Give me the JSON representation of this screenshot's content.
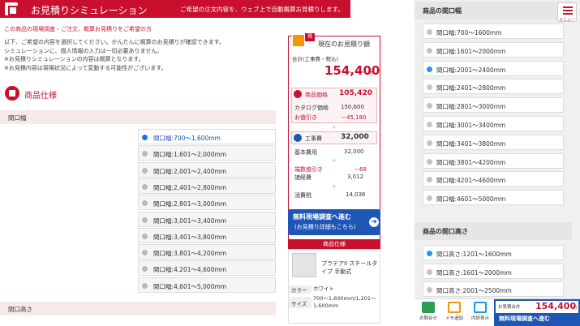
{
  "header": {
    "title": "お見積りシミュレーション",
    "subtitle": "ご希望の注文内容を、ウェブ上で自動概算お見積りします。"
  },
  "note_red": "この商品の現場調査・ご注文、概算お見積りをご希望の方",
  "intro": [
    "以下、ご希望の内容を選択してください。かんたんに概算のお見積りが確認できます。",
    "シミュレーションに、個人情報の入力は一切必要ありません。",
    "※お見積りシミュレーションの内容は概算となります。",
    "※お見積内容は現場状況によって変動する可能性がございます。"
  ],
  "spec_title": "商品仕様",
  "width_section": {
    "label": "間口幅",
    "options": [
      "間口幅:700～1,600mm",
      "間口幅:1,601～2,000mm",
      "間口幅:2,001～2,400mm",
      "間口幅:2,401～2,800mm",
      "間口幅:2,801～3,000mm",
      "間口幅:3,001～3,400mm",
      "間口幅:3,401～3,800mm",
      "間口幅:3,801～4,200mm",
      "間口幅:4,201～4,600mm",
      "間口幅:4,601～5,000mm"
    ],
    "selected": 0
  },
  "height_section": {
    "label": "間口高さ"
  },
  "estimate": {
    "badge": "得",
    "title": "現在のお見積り額",
    "total_label": "合計(工事費・税込)",
    "total": "154,400",
    "yen": "円",
    "product_label": "商品価格",
    "product_price": "105,420",
    "catalog_label": "カタログ価格",
    "catalog_price": "150,600",
    "discount_label": "お値引き",
    "discount": "－45,180",
    "work_label": "工事費",
    "work_price": "32,000",
    "base_label": "基本費用",
    "base_price": "32,000",
    "end_label": "端数値引き",
    "end_discount": "－68",
    "misc_label": "諸経費",
    "misc_price": "3,012",
    "tax_label": "消費税",
    "tax": "14,036",
    "plus": "+",
    "cta_1": "無料現場調査へ進む",
    "cta_2": "(お見積り詳細もこちら)"
  },
  "product_spec": {
    "header": "商品仕様",
    "name": "プラテアII スチールタイプ 手動式",
    "color_label": "カラー",
    "color": "ホワイト",
    "size_label": "サイズ",
    "size": "700～1,600mm/1,201～1,600mm"
  },
  "right": {
    "width_head": "商品の間口幅",
    "width_opts": [
      "間口幅:700～1600mm",
      "間口幅:1601～2000mm",
      "間口幅:2001～2400mm",
      "間口幅:2401～2800mm",
      "間口幅:2801～3000mm",
      "間口幅:3001～3400mm",
      "間口幅:3401～3800mm",
      "間口幅:3801～4200mm",
      "間口幅:4201～4600mm",
      "間口幅:4601～5000mm"
    ],
    "width_selected": 2,
    "height_head": "商品の間口高さ",
    "height_opts": [
      "間口高さ:1201～1600mm",
      "間口高さ:1601～2000mm",
      "間口高さ:2001～2500mm"
    ],
    "height_selected": 0,
    "menu": "メニュー",
    "bb_contact": "お問合せ",
    "bb_memo": "メモ追加",
    "bb_internal": "内訳表示",
    "bb_est_label": "お見積合計",
    "bb_est_val": "154,400",
    "bb_yen": "円",
    "bb_cta": "無料現場調査へ進む"
  },
  "colors": {
    "brand": "#c8102e",
    "accent": "#1e56b5"
  }
}
